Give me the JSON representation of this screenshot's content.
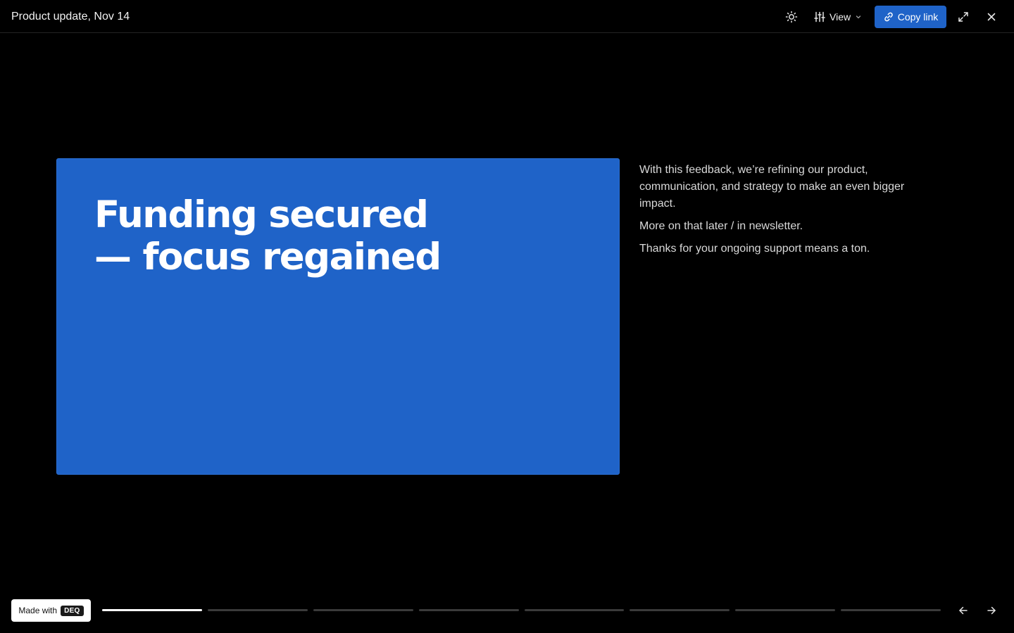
{
  "header": {
    "title": "Product update, Nov 14",
    "theme_icon": "sun-icon",
    "view_label": "View",
    "view_icon": "sliders-icon",
    "copy_link_label": "Copy link",
    "copy_link_icon": "link-icon",
    "fullscreen_icon": "expand-icon",
    "close_icon": "close-icon"
  },
  "slide": {
    "heading_line1": "Funding secured",
    "heading_line2": "— focus regained",
    "background_color": "#1f63c8"
  },
  "notes": {
    "paragraphs": [
      "With this feedback, we’re refining our product, communication, and strategy to make an even bigger impact.",
      "More on that later / in newsletter.",
      "Thanks for your ongoing support means a ton."
    ]
  },
  "footer": {
    "made_with_label": "Made with",
    "brand_badge": "DEQ",
    "progress": {
      "total_slides": 8,
      "current_slide": 1
    },
    "prev_icon": "arrow-left-icon",
    "next_icon": "arrow-right-icon"
  },
  "colors": {
    "accent": "#1f63c8",
    "background": "#000000"
  }
}
